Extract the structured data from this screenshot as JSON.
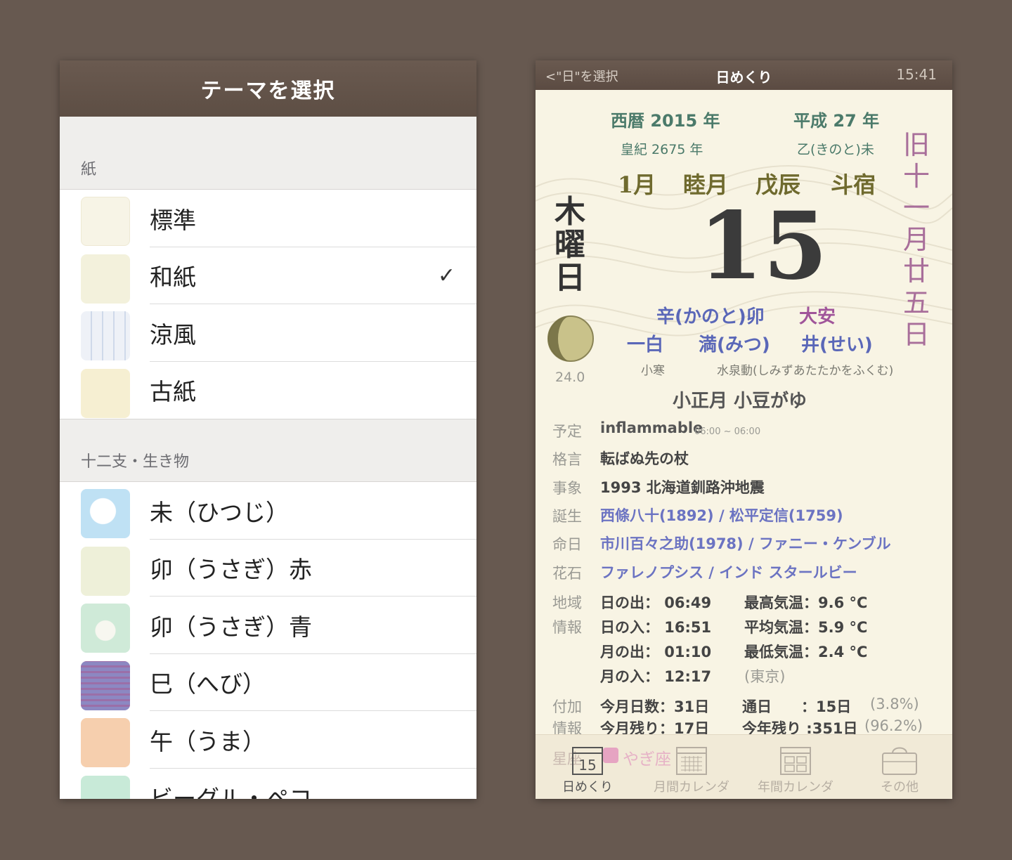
{
  "left": {
    "header_title": "テーマを選択",
    "section1_title": "紙",
    "section1_items": [
      {
        "label": "標準",
        "checked": false,
        "thumb_color": "#f7f4e6"
      },
      {
        "label": "和紙",
        "checked": true,
        "thumb_color": "#f3f1dc"
      },
      {
        "label": "涼風",
        "checked": false,
        "thumb_color": "#eef1f7"
      },
      {
        "label": "古紙",
        "checked": false,
        "thumb_color": "#f6efd2"
      }
    ],
    "check_mark": "✓",
    "section2_title": "十二支・生き物",
    "section2_items": [
      {
        "label": "未（ひつじ）",
        "thumb_color": "#bfe1f4"
      },
      {
        "label": "卯（うさぎ）赤",
        "thumb_color": "#eef0d9"
      },
      {
        "label": "卯（うさぎ）青",
        "thumb_color": "#cfead8"
      },
      {
        "label": "巳（へび）",
        "thumb_color": "#8c88c2"
      },
      {
        "label": "午（うま）",
        "thumb_color": "#f6cfae"
      },
      {
        "label": "ビーグル・ペコ",
        "thumb_color": "#c8ead8"
      }
    ]
  },
  "right": {
    "back_label": "<\"日\"を選択",
    "title": "日めくり",
    "time": "15:41",
    "seireki": "西暦 2015 年",
    "heisei": "平成 27 年",
    "kouki": "皇紀 2675 年",
    "eto_year": "乙(きのと)未",
    "month": "1月",
    "month_name": "睦月",
    "month_kanshi": "戊辰",
    "shuku": "斗宿",
    "weekday_chars": [
      "木",
      "曜",
      "日"
    ],
    "day": "15",
    "lunar_chars": [
      "旧",
      "十",
      "一",
      "月",
      "廿",
      "五",
      "日"
    ],
    "day_kanshi": "辛(かのと)卯",
    "rokuyo": "大安",
    "kyusei": "一白",
    "juunichoku": "満(みつ)",
    "shuku2": "井(せい)",
    "moon_age": "24.0",
    "sekki": "小寒",
    "kou": "水泉動(しみずあたたかをふくむ)",
    "event_title": "小正月 小豆がゆ",
    "yotei_label": "予定",
    "yotei_value": "inflammable",
    "yotei_time": "06:00 ~ 06:00",
    "kakugen_label": "格言",
    "kakugen_value": "転ばぬ先の杖",
    "jishou_label": "事象",
    "jishou_value": "1993 北海道釧路沖地震",
    "tanjou_label": "誕生",
    "tanjou_value": "西條八十(1892) / 松平定信(1759)",
    "meinichi_label": "命日",
    "meinichi_value": "市川百々之助(1978) / ファニー・ケンブル",
    "kaseki_label": "花石",
    "kaseki_value": "ファレノプシス / インド スタールビー",
    "chiiki_label1": "地域",
    "chiiki_label2": "情報",
    "sunrise": "日の出： 06:49",
    "sunset": "日の入： 16:51",
    "moonrise": "月の出： 01:10",
    "moonset": "月の入： 12:17",
    "max_temp": "最高気温：9.6 °C",
    "avg_temp": "平均気温：5.9 °C",
    "min_temp": "最低気温：2.4 °C",
    "location": "(東京)",
    "fuka_label1": "付加",
    "fuka_label2": "情報",
    "month_days": "今月日数：31日",
    "tsuujitsu": "通日　　：15日",
    "tsuujitsu_pct": "(3.8%)",
    "month_left": "今月残り：17日",
    "year_left": "今年残り :351日",
    "year_left_pct": "(96.2%)",
    "seiza_label": "星座",
    "seiza_value": "やぎ座",
    "tab_icon_day": "15",
    "tabs": [
      "日めくり",
      "月間カレンダ",
      "年間カレンダ",
      "その他"
    ]
  }
}
